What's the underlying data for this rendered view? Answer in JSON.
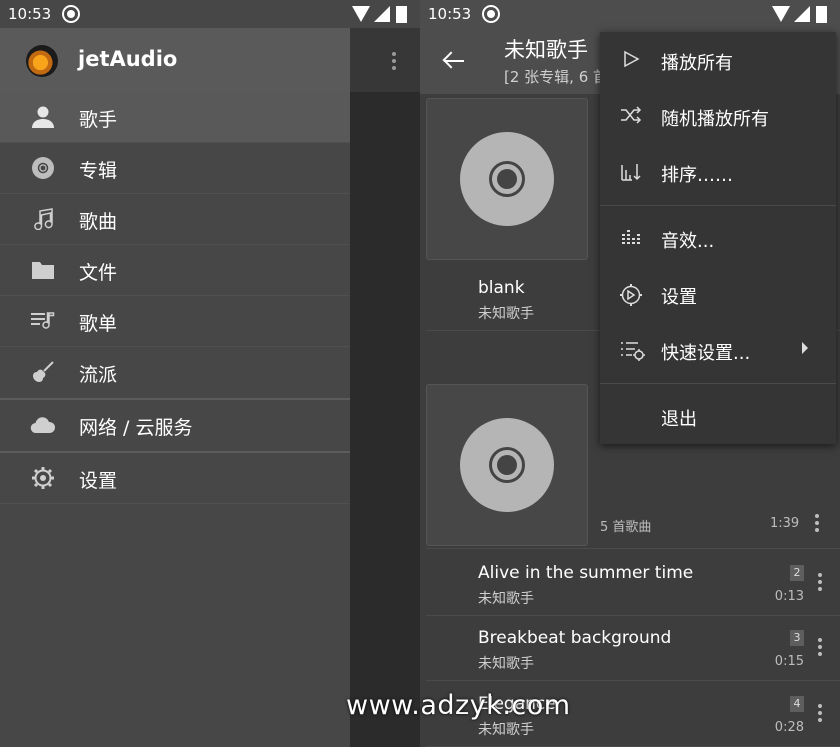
{
  "status_bar": {
    "time": "10:53"
  },
  "drawer": {
    "app_title": "jetAudio",
    "items": [
      {
        "label": "歌手",
        "icon": "person-icon"
      },
      {
        "label": "专辑",
        "icon": "album-disc-icon"
      },
      {
        "label": "歌曲",
        "icon": "music-note-icon"
      },
      {
        "label": "文件",
        "icon": "folder-icon"
      },
      {
        "label": "歌单",
        "icon": "playlist-icon"
      },
      {
        "label": "流派",
        "icon": "guitar-icon"
      },
      {
        "label": "网络 / 云服务",
        "icon": "cloud-icon"
      },
      {
        "label": "设置",
        "icon": "gear-icon"
      }
    ]
  },
  "artist_view": {
    "title": "未知歌手",
    "subtitle": "[2 张专辑, 6 首",
    "album_track": {
      "title": "blank",
      "artist": "未知歌手"
    },
    "album2_info": "5 首歌曲",
    "album2_duration": "1:39",
    "tracks": [
      {
        "title": "Alive in the summer time",
        "artist": "未知歌手",
        "number": "2",
        "duration": "0:13"
      },
      {
        "title": "Breakbeat background",
        "artist": "未知歌手",
        "number": "3",
        "duration": "0:15"
      },
      {
        "title": "Elegance",
        "artist": "未知歌手",
        "number": "4",
        "duration": "0:28"
      }
    ]
  },
  "menu": {
    "items": [
      {
        "label": "播放所有",
        "icon": "play-icon"
      },
      {
        "label": "随机播放所有",
        "icon": "shuffle-icon"
      },
      {
        "label": "排序……",
        "icon": "sort-icon"
      },
      {
        "label": "音效...",
        "icon": "equalizer-icon"
      },
      {
        "label": "设置",
        "icon": "settings-icon"
      },
      {
        "label": "快速设置...",
        "icon": "quick-settings-icon"
      },
      {
        "label": "退出",
        "icon": ""
      }
    ]
  },
  "watermark": "www.adzyk.com"
}
